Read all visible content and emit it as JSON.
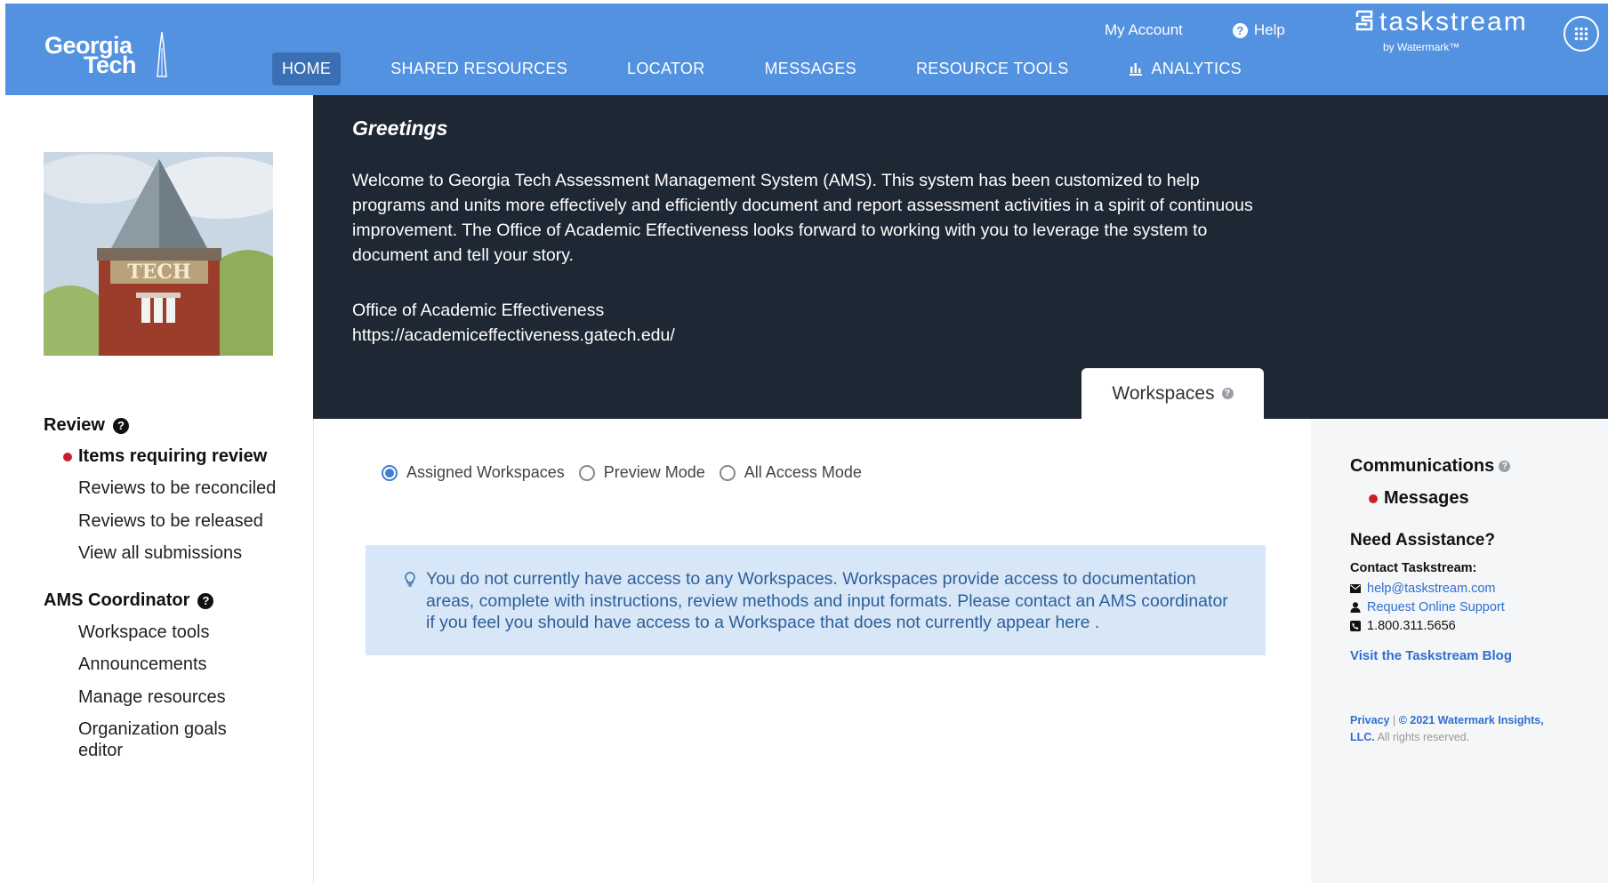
{
  "header": {
    "logo": {
      "line1": "Georgia",
      "line2": "Tech"
    },
    "nav": [
      {
        "label": "HOME",
        "active": true
      },
      {
        "label": "SHARED RESOURCES"
      },
      {
        "label": "LOCATOR"
      },
      {
        "label": "MESSAGES"
      },
      {
        "label": "RESOURCE TOOLS"
      },
      {
        "label": "ANALYTICS",
        "icon": "bar-chart-icon"
      }
    ],
    "my_account": "My Account",
    "help": "Help",
    "brand": {
      "name": "taskstream",
      "sub": "by Watermark™"
    },
    "colors": {
      "bar": "#5292e0",
      "active_tab": "#3a6fb3"
    }
  },
  "sidebar": {
    "review": {
      "heading": "Review",
      "items": [
        {
          "label": "Items requiring review",
          "bold": true,
          "alert": true
        },
        {
          "label": "Reviews to be reconciled"
        },
        {
          "label": "Reviews to be released"
        },
        {
          "label": "View all submissions"
        }
      ]
    },
    "coordinator": {
      "heading": "AMS Coordinator",
      "items": [
        {
          "label": "Workspace tools"
        },
        {
          "label": "Announcements"
        },
        {
          "label": "Manage resources"
        },
        {
          "label": "Organization goals editor"
        }
      ]
    }
  },
  "greeting": {
    "title": "Greetings",
    "body": "Welcome to Georgia Tech Assessment Management System (AMS). This system has been customized to help programs and units more effectively and efficiently document and report assessment activities in a spirit of continuous improvement. The Office of Academic Effectiveness looks forward to working with you to leverage the system to document and tell your story.",
    "office": "Office of Academic Effectiveness",
    "url": "https://academiceffectiveness.gatech.edu/"
  },
  "workspaces": {
    "tab_label": "Workspaces",
    "modes": [
      {
        "label": "Assigned Workspaces",
        "checked": true
      },
      {
        "label": "Preview Mode",
        "checked": false
      },
      {
        "label": "All Access Mode",
        "checked": false
      }
    ],
    "notice": "You do not currently have access to any Workspaces. Workspaces provide access to documentation areas, complete with instructions, review methods and input formats. Please contact an AMS coordinator if you feel you should have access to a Workspace that does not currently appear here ."
  },
  "right": {
    "communications": "Communications",
    "messages": "Messages",
    "assist_heading": "Need Assistance?",
    "contact_label": "Contact Taskstream:",
    "email": "help@taskstream.com",
    "support": "Request Online Support",
    "phone": "1.800.311.5656",
    "blog": "Visit the Taskstream Blog",
    "privacy": "Privacy",
    "copyright": "© 2021 Watermark Insights, LLC.",
    "rights": "All rights reserved."
  }
}
